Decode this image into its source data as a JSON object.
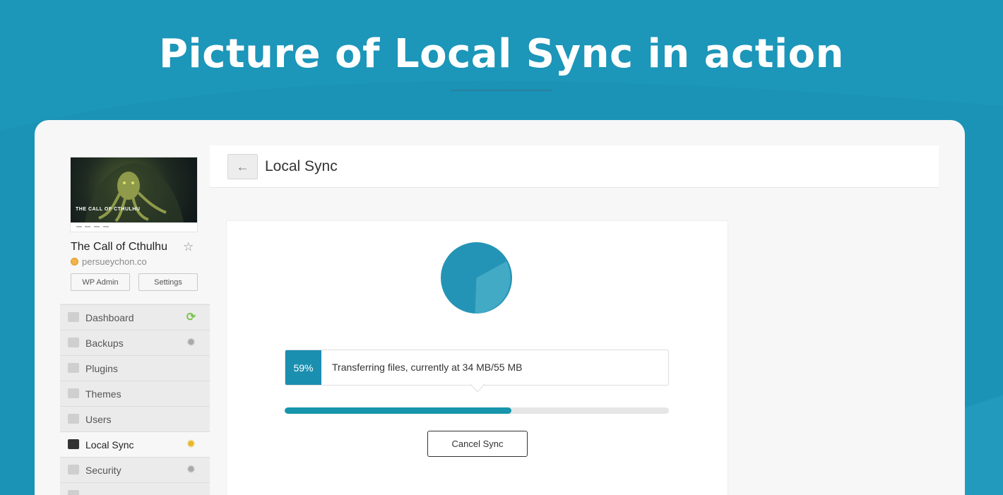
{
  "banner": {
    "headline": "Picture of Local Sync in action"
  },
  "site": {
    "name": "The Call of Cthulhu",
    "domain": "persueychon.co",
    "thumbnail_title": "THE CALL OF CTHULHU",
    "buttons": {
      "wp_admin": "WP Admin",
      "settings": "Settings"
    }
  },
  "sidebar": {
    "items": [
      {
        "label": "Dashboard",
        "icon": "monitor-icon",
        "right_icon": "sync-icon"
      },
      {
        "label": "Backups",
        "icon": "backup-icon",
        "right_icon": "gear-icon"
      },
      {
        "label": "Plugins",
        "icon": "plug-icon",
        "right_icon": ""
      },
      {
        "label": "Themes",
        "icon": "palette-icon",
        "right_icon": ""
      },
      {
        "label": "Users",
        "icon": "user-icon",
        "right_icon": ""
      },
      {
        "label": "Local Sync",
        "icon": "local-sync-icon",
        "right_icon": "gear-icon",
        "active": true
      },
      {
        "label": "Security",
        "icon": "shield-icon",
        "right_icon": "gear-icon"
      }
    ]
  },
  "header": {
    "title": "Local Sync",
    "back_icon": "arrow-left-icon"
  },
  "sync": {
    "percent_label": "59%",
    "progress": 0.59,
    "status": "Transferring files, currently at 34 MB/55 MB",
    "cancel_label": "Cancel Sync"
  },
  "colors": {
    "background": "#1b93b6",
    "accent": "#1b8fb0",
    "progress": "#1795ad",
    "gear_active": "#e9b829",
    "sync_green": "#7cc34a"
  }
}
